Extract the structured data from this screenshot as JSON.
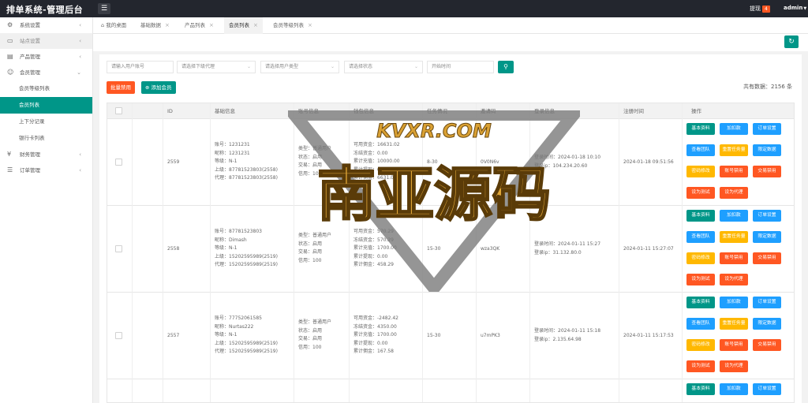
{
  "app": {
    "title": "排单系统-管理后台",
    "menu_icon": "menu-icon"
  },
  "header": {
    "notice_label": "提现",
    "notice_count": "4",
    "user": "admin"
  },
  "sidebar": {
    "items": [
      {
        "label": "系统设置",
        "icon": "gear-icon"
      },
      {
        "label": "站点设置",
        "icon": "monitor-icon"
      },
      {
        "label": "产品管理",
        "icon": "box-icon"
      },
      {
        "label": "会员管理",
        "icon": "user-icon"
      },
      {
        "label": "会员等级列表"
      },
      {
        "label": "会员列表"
      },
      {
        "label": "上下分记录"
      },
      {
        "label": "银行卡列表"
      },
      {
        "label": "财务管理",
        "icon": "money-icon"
      },
      {
        "label": "订单管理",
        "icon": "order-icon"
      }
    ]
  },
  "tabs": [
    {
      "label": "我的桌面"
    },
    {
      "label": "基础数据"
    },
    {
      "label": "产品列表"
    },
    {
      "label": "会员列表"
    },
    {
      "label": "会员等级列表"
    }
  ],
  "filters": {
    "account_placeholder": "请输入用户账号",
    "agent_placeholder": "请选择下级代理",
    "usertype_placeholder": "请选择用户类型",
    "status_placeholder": "请选择状态",
    "time_placeholder": "开始时间"
  },
  "actions": {
    "batch_ban": "批量禁用",
    "add_member": "添加会员",
    "total": "共有数据：2156 条"
  },
  "table": {
    "headers": [
      "ID",
      "基础信息",
      "账号信息",
      "钱包信息",
      "任务情况",
      "邀请码",
      "登录信息",
      "注册时间",
      "操作"
    ],
    "buttons": [
      "基本资料",
      "加扣款",
      "订单设置",
      "查看团队",
      "重置任务量",
      "限定数据",
      "密码修改",
      "账号禁用",
      "交易禁用",
      "设为测试",
      "设为代理"
    ],
    "rows": [
      {
        "id": "2559",
        "basic": [
          "账号：1231231",
          "昵称：1231231",
          "等级：N-1",
          "上级：87781523803(2558)",
          "代理：87781523803(2558)"
        ],
        "account": [
          "类型：普通用户",
          "状态：启用",
          "交易：启用",
          "信用：100"
        ],
        "wallet": [
          "可用资金：16631.02",
          "冻结资金：0.00",
          "累计充值：10000.00",
          "累计提现：0.00",
          "累计佣金：6631.02"
        ],
        "task": "8-30",
        "invite": "0V0N6v",
        "login": [
          "登录时间：2024-01-18 10:10",
          "登录ip：104.234.20.60"
        ],
        "reg": "2024-01-18 09:51:56"
      },
      {
        "id": "2558",
        "basic": [
          "账号：87781523803",
          "昵称：Dimash",
          "等级：N-1",
          "上级：15202595989(2519)",
          "代理：15202595989(2519)"
        ],
        "account": [
          "类型：普通用户",
          "状态：启用",
          "交易：启用",
          "信用：100"
        ],
        "wallet": [
          "可用资金：570.29",
          "冻结资金：570.29",
          "累计充值：1700.00",
          "累计提现：0.00",
          "累计佣金：458.29"
        ],
        "task": "15-30",
        "invite": "wza3QK",
        "login": [
          "登录时间：2024-01-11 15:27",
          "登录ip：31.132.80.0"
        ],
        "reg": "2024-01-11 15:27:07"
      },
      {
        "id": "2557",
        "basic": [
          "账号：77752061585",
          "昵称：Nurtas222",
          "等级：N-1",
          "上级：15202595989(2519)",
          "代理：15202595989(2519)"
        ],
        "account": [
          "类型：普通用户",
          "状态：启用",
          "交易：启用",
          "信用：100"
        ],
        "wallet": [
          "可用资金：-2482.42",
          "冻结资金：4350.00",
          "累计充值：1700.00",
          "累计提现：0.00",
          "累计佣金：167.58"
        ],
        "task": "15-30",
        "invite": "u7mPK3",
        "login": [
          "登录时间：2024-01-11 15:18",
          "登录ip：2.135.64.98"
        ],
        "reg": "2024-01-11 15:17:53"
      }
    ]
  },
  "watermark": {
    "top": "KVXR.COM",
    "main": "南亚源码"
  },
  "colors": {
    "primary": "#009688",
    "blue": "#1e9fff",
    "orange": "#ffb800",
    "red": "#ff5722",
    "topbar": "#23262e"
  }
}
